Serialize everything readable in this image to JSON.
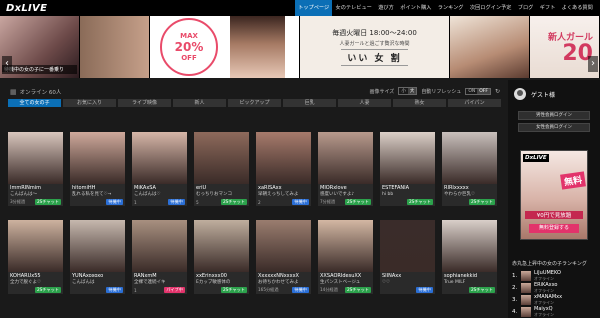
{
  "brand": {
    "logo": "DxLIVE"
  },
  "nav": {
    "items": [
      {
        "label": "トップページ"
      },
      {
        "label": "女のテレビュー"
      },
      {
        "label": "遊び方"
      },
      {
        "label": "ポイント購入"
      },
      {
        "label": "ランキング"
      },
      {
        "label": "次回ログイン予定"
      },
      {
        "label": "ブログ"
      },
      {
        "label": "ギフト"
      },
      {
        "label": "よくある質問"
      }
    ]
  },
  "banners": {
    "b1_caption": "待機中の女の子に一番乗り",
    "b3_line1": "MAX",
    "b3_line2": "20%",
    "b3_line3": "OFF",
    "b4_line1": "毎週火曜日 18:00～24:00",
    "b4_line2": "人妻ガールと過ごす贅沢な時間",
    "b4_line3": "いい 女 割",
    "b6_line1": "新人ガール",
    "b6_line2": "20"
  },
  "filters": {
    "online_label": "オンライン 60人",
    "size_label": "画像サイズ",
    "size_small": "小",
    "size_large": "大",
    "refresh_label": "自動リフレッシュ",
    "refresh_on": "ON",
    "refresh_off": "OFF",
    "categories": [
      {
        "label": "全ての女の子"
      },
      {
        "label": "お気に入り"
      },
      {
        "label": "ライブ映像"
      },
      {
        "label": "新人"
      },
      {
        "label": "ピックアップ"
      },
      {
        "label": "巨乳"
      },
      {
        "label": "人妻"
      },
      {
        "label": "熟女"
      },
      {
        "label": "パイパン"
      }
    ]
  },
  "cards": [
    {
      "name": "ImmRINmim",
      "msg": "こんばんは〜",
      "time": "3分経過",
      "badge": "2Sチャット",
      "color": "#d9c6bd"
    },
    {
      "name": "hitomiHH",
      "msg": "乱れる私を見て♡→",
      "time": "",
      "badge": "待機中",
      "color": "#cfa99b"
    },
    {
      "name": "MiKAxSA",
      "msg": "こんばんは♡",
      "time": "1",
      "badge": "待機中",
      "color": "#d6b6a8"
    },
    {
      "name": "eriU",
      "msg": "むっちりおマンコ",
      "time": "5",
      "badge": "2Sチャット",
      "color": "#8e6a5c"
    },
    {
      "name": "xaRISAxx",
      "msg": "早朝えっちしてみよ",
      "time": "2",
      "badge": "待機中",
      "color": "#a77b6c"
    },
    {
      "name": "MIORxlove",
      "msg": "感度いいですよ♪",
      "time": "7分経過",
      "badge": "2Sチャット",
      "color": "#b89a8d"
    },
    {
      "name": "ESTEFANIA",
      "msg": "hi bb",
      "time": "",
      "badge": "2Sチャット",
      "color": "#dcd0c8"
    },
    {
      "name": "RIRIxxxxx",
      "msg": "やわらか巨乳♡",
      "time": "",
      "badge": "2Sチャット",
      "color": "#c9c0bc"
    },
    {
      "name": "KOHARUx55",
      "msg": "全力で脱ぐよ♡",
      "time": "",
      "badge": "2Sチャット",
      "color": "#cdb29f"
    },
    {
      "name": "YUNAxoxoxo",
      "msg": "こんばんは",
      "time": "",
      "badge": "待機中",
      "color": "#c6b8ae"
    },
    {
      "name": "RANxmM",
      "msg": "全裸で連続イキ",
      "time": "1",
      "badge": "パイブ中",
      "color": "#a89080"
    },
    {
      "name": "xxErinxxx00",
      "msg": "Eカップ敏感体の",
      "time": "",
      "badge": "2Sチャット",
      "color": "#bfae9e"
    },
    {
      "name": "XxxxxxNNxxxxX",
      "msg": "お待ちかわせてみよ",
      "time": "165分経過",
      "badge": "待機中",
      "color": "#9a7d6f"
    },
    {
      "name": "XXSAORIdesuXX",
      "msg": "生パンストベージュ",
      "time": "14分経過",
      "badge": "2Sチャット",
      "color": "#d3b7a3"
    },
    {
      "name": "SIINAxx",
      "msg": "♡♡",
      "time": "",
      "badge": "待機中",
      "color": "#3a2c2a"
    },
    {
      "name": "sophianekkid",
      "msg": "True MILF",
      "time": "",
      "badge": "2Sチャット",
      "color": "#d9cfc9"
    }
  ],
  "sidebar": {
    "guest_label": "ゲスト様",
    "male_login": "男性会員ログイン",
    "female_login": "女性会員ログイン",
    "ad_logo": "DxLIVE",
    "ad_free": "無料",
    "ad_yen": "¥0円で見放題",
    "ad_register": "無料登録する",
    "ranking_title": "赤丸急上昇中の女の子ランキング",
    "ranks": [
      {
        "num": "1.",
        "name": "LiJuUMEKO",
        "stat": "オフライン"
      },
      {
        "num": "2.",
        "name": "ERiKAxxo",
        "stat": "オフライン"
      },
      {
        "num": "3.",
        "name": "xMANAMxx",
        "stat": "オフライン"
      },
      {
        "num": "4.",
        "name": "MaiyxQ",
        "stat": "オフライン"
      }
    ]
  },
  "colors": {
    "accent": "#0b6fb6",
    "pink": "#e2336b",
    "green": "#2ca24c"
  }
}
